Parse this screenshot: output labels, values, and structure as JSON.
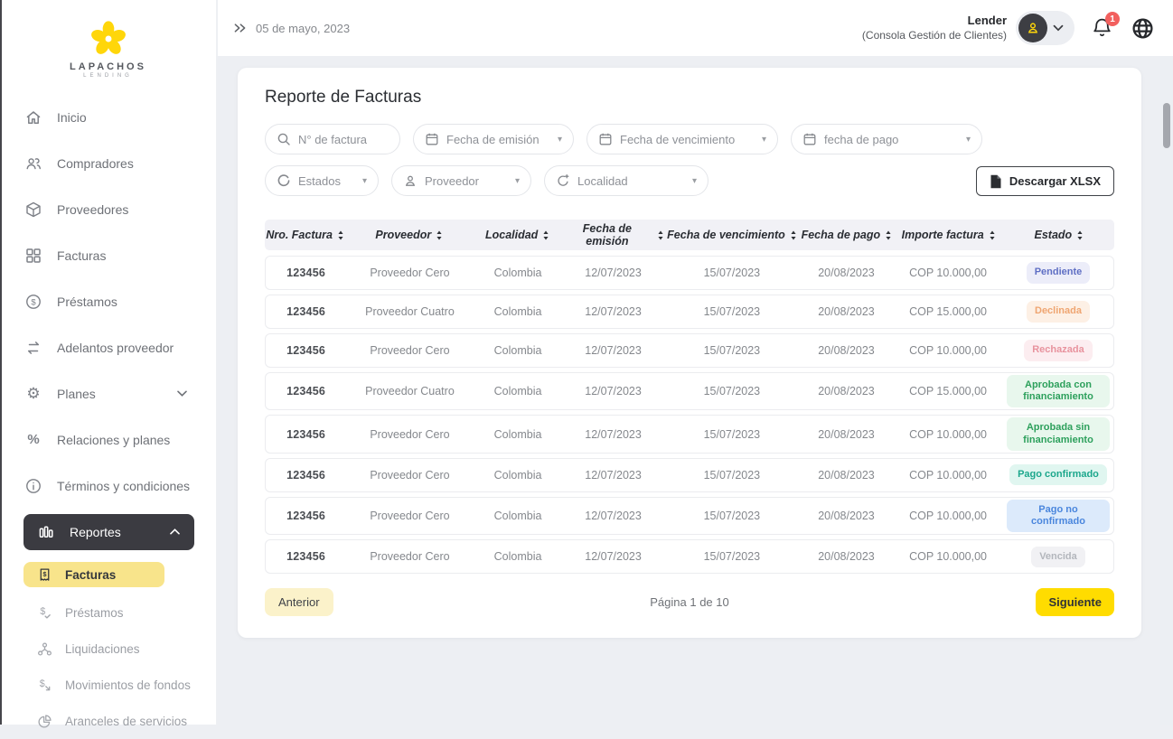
{
  "brand": {
    "name": "LAPACHOS",
    "tagline": "LENDING",
    "flower_color": "#ffd60a"
  },
  "topbar": {
    "date": "05 de mayo, 2023",
    "user_role": "Lender",
    "user_subtitle": "(Consola Gestión de Clientes)",
    "notification_count": "1"
  },
  "sidebar": {
    "items": [
      {
        "label": "Inicio"
      },
      {
        "label": "Compradores"
      },
      {
        "label": "Proveedores"
      },
      {
        "label": "Facturas"
      },
      {
        "label": "Préstamos"
      },
      {
        "label": "Adelantos proveedor"
      },
      {
        "label": "Planes",
        "chevron": "v"
      },
      {
        "label": "Relaciones y planes"
      },
      {
        "label": "Términos y condiciones"
      },
      {
        "label": "Reportes",
        "active": true,
        "expanded": true,
        "children": [
          {
            "label": "Facturas",
            "active": true
          },
          {
            "label": "Préstamos"
          },
          {
            "label": "Liquidaciones"
          },
          {
            "label": "Movimientos de fondos"
          },
          {
            "label": "Aranceles de servicios"
          }
        ]
      }
    ]
  },
  "page": {
    "title": "Reporte de Facturas"
  },
  "filters": {
    "invoice_search_placeholder": "N° de factura",
    "emission_date": "Fecha de emisión",
    "due_date": "Fecha de vencimiento",
    "payment_date": "fecha de pago",
    "states": "Estados",
    "provider": "Proveedor",
    "locality": "Localidad"
  },
  "actions": {
    "download_label": "Descargar XLSX"
  },
  "table": {
    "columns": [
      "Nro. Factura",
      "Proveedor",
      "Localidad",
      "Fecha de emisión",
      "Fecha de vencimiento",
      "Fecha de pago",
      "Importe factura",
      "Estado"
    ],
    "rows": [
      {
        "nro": "123456",
        "proveedor": "Proveedor Cero",
        "localidad": "Colombia",
        "emision": "12/07/2023",
        "vencimiento": "15/07/2023",
        "pago": "20/08/2023",
        "importe": "COP 10.000,00",
        "estado": "Pendiente",
        "estado_key": "pendiente"
      },
      {
        "nro": "123456",
        "proveedor": "Proveedor Cuatro",
        "localidad": "Colombia",
        "emision": "12/07/2023",
        "vencimiento": "15/07/2023",
        "pago": "20/08/2023",
        "importe": "COP 15.000,00",
        "estado": "Declinada",
        "estado_key": "declinada"
      },
      {
        "nro": "123456",
        "proveedor": "Proveedor Cero",
        "localidad": "Colombia",
        "emision": "12/07/2023",
        "vencimiento": "15/07/2023",
        "pago": "20/08/2023",
        "importe": "COP 10.000,00",
        "estado": "Rechazada",
        "estado_key": "rechazada"
      },
      {
        "nro": "123456",
        "proveedor": "Proveedor Cuatro",
        "localidad": "Colombia",
        "emision": "12/07/2023",
        "vencimiento": "15/07/2023",
        "pago": "20/08/2023",
        "importe": "COP 15.000,00",
        "estado": "Aprobada con financiamiento",
        "estado_key": "aprobada_con"
      },
      {
        "nro": "123456",
        "proveedor": "Proveedor Cero",
        "localidad": "Colombia",
        "emision": "12/07/2023",
        "vencimiento": "15/07/2023",
        "pago": "20/08/2023",
        "importe": "COP 10.000,00",
        "estado": "Aprobada sin financiamiento",
        "estado_key": "aprobada_sin"
      },
      {
        "nro": "123456",
        "proveedor": "Proveedor Cero",
        "localidad": "Colombia",
        "emision": "12/07/2023",
        "vencimiento": "15/07/2023",
        "pago": "20/08/2023",
        "importe": "COP 10.000,00",
        "estado": "Pago confirmado",
        "estado_key": "pago_confirmado"
      },
      {
        "nro": "123456",
        "proveedor": "Proveedor Cero",
        "localidad": "Colombia",
        "emision": "12/07/2023",
        "vencimiento": "15/07/2023",
        "pago": "20/08/2023",
        "importe": "COP 10.000,00",
        "estado": "Pago no confirmado",
        "estado_key": "pago_no_confirmado"
      },
      {
        "nro": "123456",
        "proveedor": "Proveedor Cero",
        "localidad": "Colombia",
        "emision": "12/07/2023",
        "vencimiento": "15/07/2023",
        "pago": "20/08/2023",
        "importe": "COP 10.000,00",
        "estado": "Vencida",
        "estado_key": "vencida"
      }
    ]
  },
  "status_colors": {
    "pendiente": {
      "bg": "#ecedf9",
      "fg": "#5f6fc4"
    },
    "declinada": {
      "bg": "#fdf0e5",
      "fg": "#efa571"
    },
    "rechazada": {
      "bg": "#fcedf0",
      "fg": "#e8939e"
    },
    "aprobada_con": {
      "bg": "#e8f7ed",
      "fg": "#2da05c"
    },
    "aprobada_sin": {
      "bg": "#e8f7ed",
      "fg": "#2da05c"
    },
    "pago_confirmado": {
      "bg": "#e0f6f0",
      "fg": "#1ca78c"
    },
    "pago_no_confirmado": {
      "bg": "#dceafb",
      "fg": "#4a86dd"
    },
    "vencida": {
      "bg": "#f1f1f4",
      "fg": "#b3b6bc"
    }
  },
  "pagination": {
    "previous": "Anterior",
    "info": "Página 1 de 10",
    "next": "Siguiente"
  },
  "icons": {
    "breadcrumb": "chevrons-right",
    "search": "magnifier",
    "date_filters": "calendar",
    "states_filter": "refresh-circle",
    "provider_filter": "person",
    "locality_filter": "locate-plus",
    "download": "document",
    "sort": "up-down-arrows",
    "notifications": "bell",
    "language": "globe",
    "avatar": "person",
    "accent_yellow": "#ffdc00",
    "active_dark": "#3b3b41",
    "active_light_yellow": "#f8e48b"
  }
}
